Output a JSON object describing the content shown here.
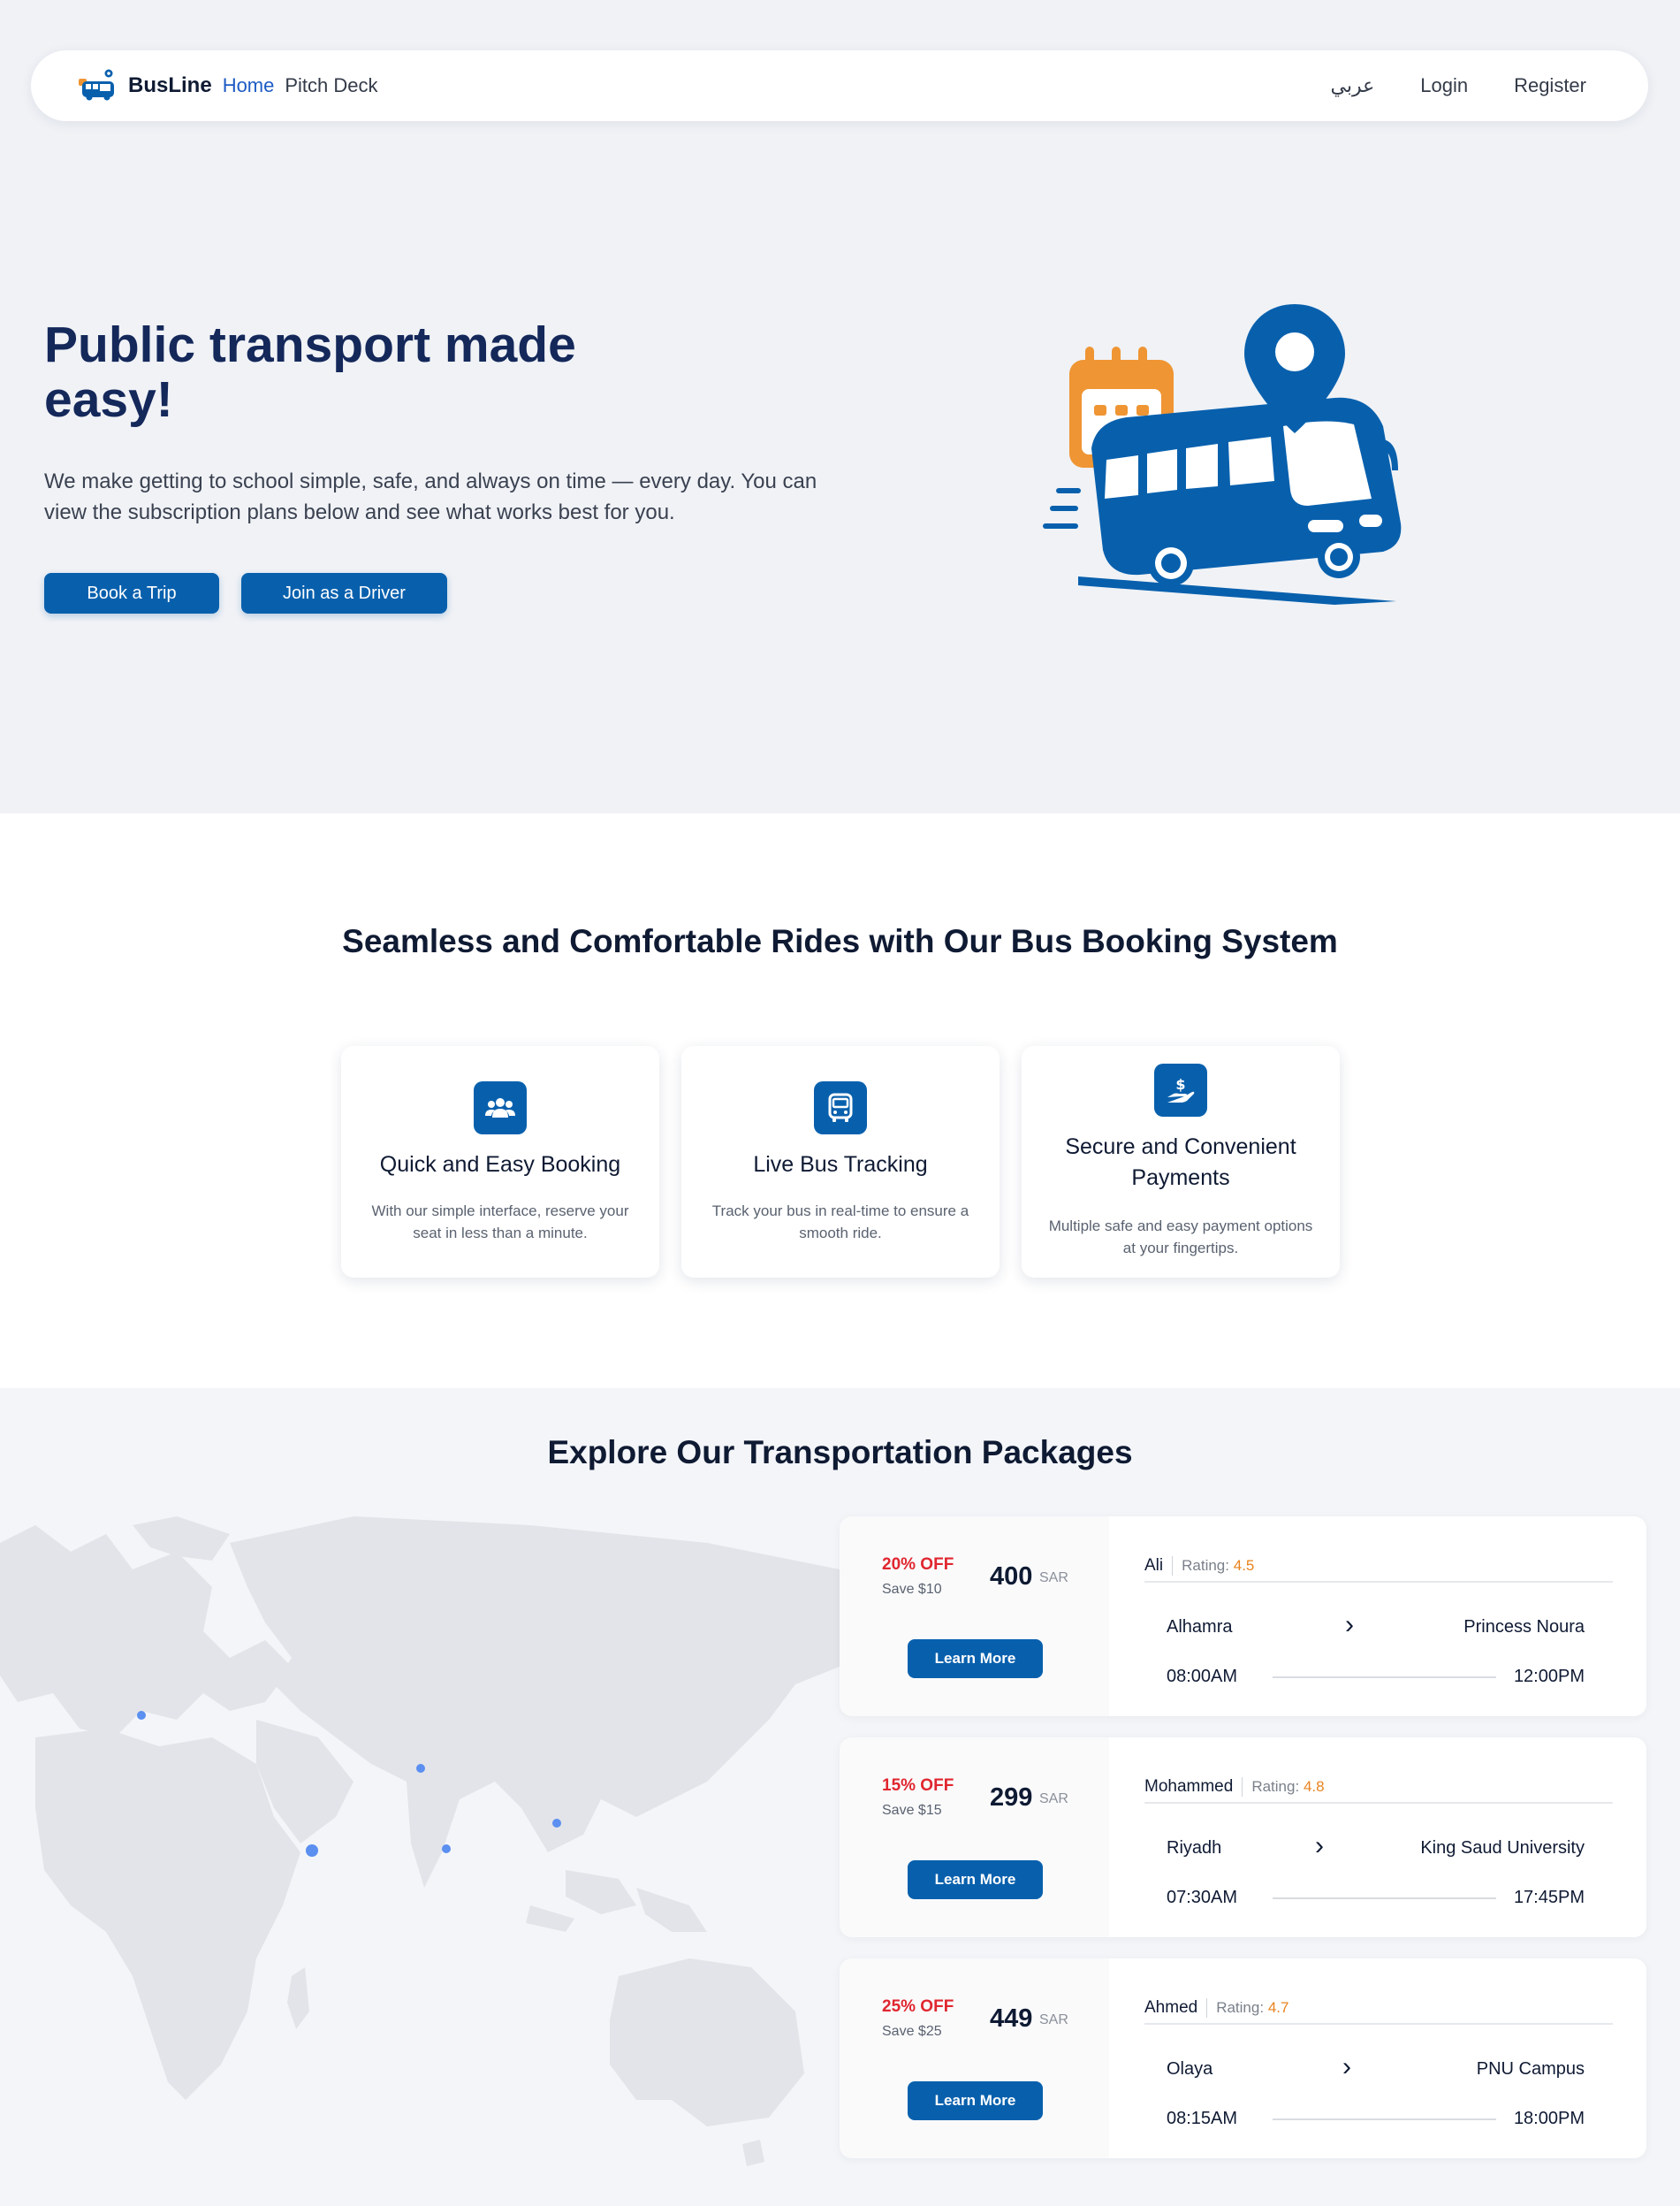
{
  "nav": {
    "brand": "BusLine",
    "links": [
      "Home",
      "Pitch Deck"
    ],
    "language": "عربي",
    "login": "Login",
    "register": "Register"
  },
  "hero": {
    "title": "Public transport made easy!",
    "subtitle": "We make getting to school simple, safe, and always on time — every day. You can view the subscription plans below and see what works best for you.",
    "book_button": "Book a Trip",
    "driver_button": "Join as a Driver"
  },
  "features": {
    "heading": "Seamless and Comfortable Rides with Our Bus Booking System",
    "cards": [
      {
        "icon": "users-icon",
        "title": "Quick and Easy Booking",
        "text": "With our simple interface, reserve your seat in less than a minute."
      },
      {
        "icon": "bus-icon",
        "title": "Live Bus Tracking",
        "text": "Track your bus in real-time to ensure a smooth ride."
      },
      {
        "icon": "payment-hand-icon",
        "title": "Secure and Convenient Payments",
        "text": "Multiple safe and easy payment options at your fingertips."
      }
    ]
  },
  "packages": {
    "heading": "Explore Our Transportation Packages",
    "items": [
      {
        "off": "20% OFF",
        "save": "Save $10",
        "price": "400",
        "currency": "SAR",
        "button": "Learn More",
        "driver": "Ali",
        "rating_label": "Rating:",
        "rating": "4.5",
        "from": "Alhamra",
        "to": "Princess Noura",
        "depart": "08:00AM",
        "arrive": "12:00PM"
      },
      {
        "off": "15% OFF",
        "save": "Save $15",
        "price": "299",
        "currency": "SAR",
        "button": "Learn More",
        "driver": "Mohammed",
        "rating_label": "Rating:",
        "rating": "4.8",
        "from": "Riyadh",
        "to": "King Saud University",
        "depart": "07:30AM",
        "arrive": "17:45PM"
      },
      {
        "off": "25% OFF",
        "save": "Save $25",
        "price": "449",
        "currency": "SAR",
        "button": "Learn More",
        "driver": "Ahmed",
        "rating_label": "Rating:",
        "rating": "4.7",
        "from": "Olaya",
        "to": "PNU Campus",
        "depart": "08:15AM",
        "arrive": "18:00PM"
      }
    ]
  },
  "colors": {
    "primary": "#0860ad",
    "accent_orange": "#ef9533",
    "heading": "#14285a",
    "discount_red": "#e0262f",
    "rating_orange": "#e8831f"
  }
}
